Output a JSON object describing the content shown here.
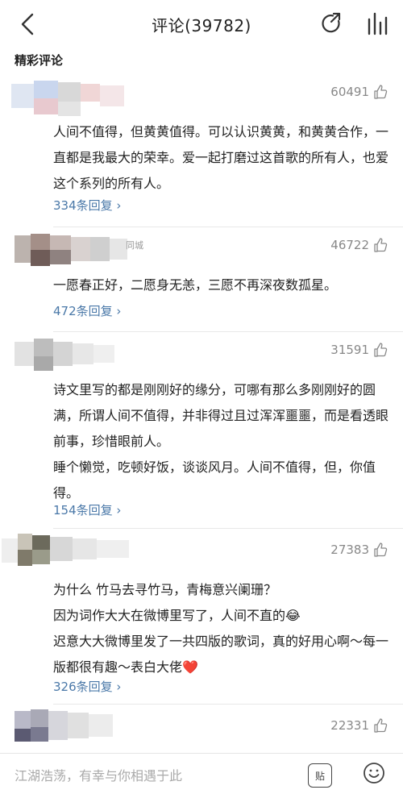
{
  "header": {
    "title": "评论(39782)",
    "back_icon": "chevron-left-icon",
    "share_icon": "share-refresh-icon",
    "rank_icon": "bar-chart-icon"
  },
  "section": {
    "title": "精彩评论"
  },
  "comments": [
    {
      "likes": "60491",
      "text": "人间不值得，但黄黄值得。可以认识黄黄，和黄黄合作，一直都是我最大的荣幸。爱一起打磨过这首歌的所有人，也爱这个系列的所有人。",
      "replies": "334条回复 ›"
    },
    {
      "likes": "46722",
      "tag": "同城",
      "text": "一愿春正好，二愿身无恙，三愿不再深夜数孤星。",
      "replies": "472条回复 ›"
    },
    {
      "likes": "31591",
      "text_lines": [
        "诗文里写的都是刚刚好的缘分，可哪有那么多刚刚好的圆满，所谓人间不值得，并非得过且过浑浑噩噩，而是看透眼前事，珍惜眼前人。",
        "睡个懒觉，吃顿好饭，谈谈风月。人间不值得，但，你值得。"
      ],
      "replies": "154条回复 ›"
    },
    {
      "likes": "27383",
      "text_lines": [
        "为什么 竹马去寻竹马，青梅意兴阑珊？",
        "因为词作大大在微博里写了，人间不直的😂",
        "迟意大大微博里发了一共四版的歌词，真的好用心啊～每一版都很有趣～表白大佬❤️"
      ],
      "replies": "326条回复 ›"
    },
    {
      "likes": "22331"
    }
  ],
  "bottom": {
    "placeholder": "江湖浩荡，有幸与你相遇于此",
    "sticker_label": "贴",
    "emoji_icon": "smile-icon"
  },
  "colors": {
    "reply_link": "#4a78a8",
    "muted": "#888888"
  }
}
